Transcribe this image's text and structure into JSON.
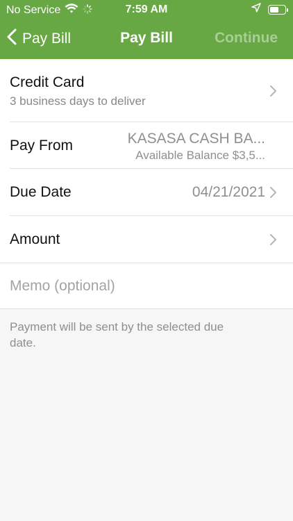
{
  "status_bar": {
    "carrier": "No Service",
    "time": "7:59 AM",
    "icons": [
      "wifi-icon",
      "activity-spinner-icon",
      "location-arrow-icon",
      "battery-icon"
    ]
  },
  "nav": {
    "back_label": "Pay Bill",
    "title": "Pay Bill",
    "continue_label": "Continue"
  },
  "form": {
    "payee": {
      "title": "Credit Card",
      "subtitle": "3 business days to deliver"
    },
    "pay_from": {
      "label": "Pay From",
      "account_name": "KASASA CASH BA...",
      "balance": "Available Balance $3,5..."
    },
    "due_date": {
      "label": "Due Date",
      "value": "04/21/2021"
    },
    "amount": {
      "label": "Amount",
      "value": ""
    },
    "memo": {
      "placeholder": "Memo (optional)"
    }
  },
  "footnote": "Payment will be sent by the selected due date.",
  "colors": {
    "nav_green": "#67a844",
    "continue_disabled": "#a7cf94",
    "background": "#f6f6f6"
  }
}
